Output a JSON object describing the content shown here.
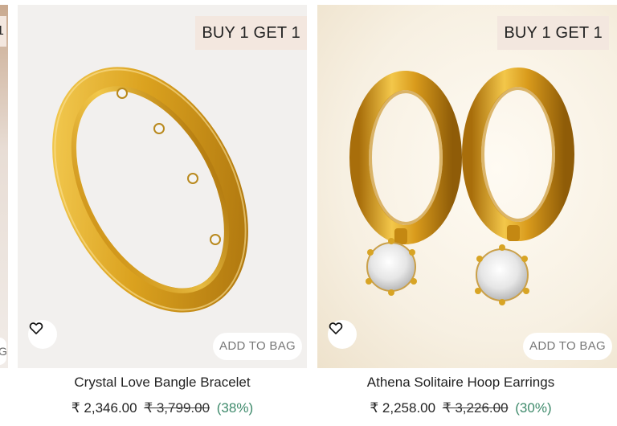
{
  "partial_card": {
    "badge_text": "1",
    "bag_text": "G"
  },
  "products": [
    {
      "name": "Crystal Love Bangle Bracelet",
      "offer_badge": "BUY 1 GET 1",
      "add_to_bag": "ADD TO BAG",
      "price": "₹ 2,346.00",
      "mrp": "₹ 3,799.00",
      "discount": "(38%)",
      "image": "gold-bangle-with-crystals",
      "wishlist_icon": "heart-outline-icon"
    },
    {
      "name": "Athena Solitaire Hoop Earrings",
      "offer_badge": "BUY 1 GET 1",
      "add_to_bag": "ADD TO BAG",
      "price": "₹ 2,258.00",
      "mrp": "₹ 3,226.00",
      "discount": "(30%)",
      "image": "gold-hoop-earrings-with-solitaire",
      "wishlist_icon": "heart-outline-icon"
    }
  ],
  "colors": {
    "badge_bg": "#f3e7df",
    "discount": "#3e8a6b",
    "gold": "#e2ad2a"
  }
}
